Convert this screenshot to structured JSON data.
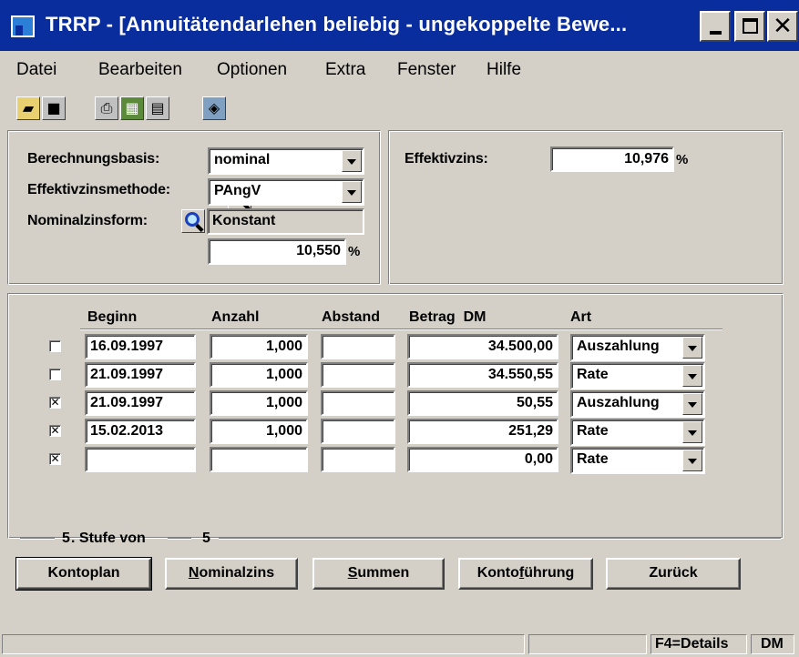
{
  "window": {
    "title": "TRRP - [Annuitätendarlehen beliebig -  ungekoppelte Bewe...",
    "minimize": "_",
    "maximize": "□",
    "close": "✕"
  },
  "menu": [
    "Datei",
    "Bearbeiten",
    "Optionen",
    "Extra",
    "Fenster",
    "Hilfe"
  ],
  "toolbar": {
    "icons": [
      "open-folder-icon",
      "save-disk-icon",
      "print-icon",
      "calculator-icon",
      "form-icon",
      "cards-icon",
      "search-icon"
    ]
  },
  "settings": {
    "berechnungsbasis_label": "Berechnungsbasis:",
    "berechnungsbasis_value": "nominal",
    "effektivzinsmethode_label": "Effektivzinsmethode:",
    "effektivzinsmethode_value": "PAngV",
    "nominalzinsform_label": "Nominalzinsform:",
    "nominalzinsform_value": "Konstant",
    "nominalzins_value": "10,550",
    "percent": "%"
  },
  "effektiv": {
    "label": "Effektivzins:",
    "value": "10,976",
    "percent": "%"
  },
  "table": {
    "headers": {
      "beginn": "Beginn",
      "anzahl": "Anzahl",
      "abstand": "Abstand",
      "betrag": "Betrag  DM",
      "art": "Art"
    },
    "rows": [
      {
        "checked": "",
        "beginn": "16.09.1997",
        "anzahl": "1,000",
        "abstand": "",
        "betrag": "34.500,00",
        "art": "Auszahlung"
      },
      {
        "checked": "",
        "beginn": "21.09.1997",
        "anzahl": "1,000",
        "abstand": "",
        "betrag": "34.550,55",
        "art": "Rate"
      },
      {
        "checked": "✕",
        "beginn": "21.09.1997",
        "anzahl": "1,000",
        "abstand": "",
        "betrag": "50,55",
        "art": "Auszahlung"
      },
      {
        "checked": "✕",
        "beginn": "15.02.2013",
        "anzahl": "1,000",
        "abstand": "",
        "betrag": "251,29",
        "art": "Rate"
      },
      {
        "checked": "✕",
        "beginn": "",
        "anzahl": "",
        "abstand": "",
        "betrag": "0,00",
        "art": "Rate"
      }
    ]
  },
  "stufe": {
    "current": "5",
    "text": ". Stufe von",
    "total": "5"
  },
  "buttons": {
    "kontoplan": "Kontoplan",
    "nominalzins_first": "N",
    "nominalzins_rest": "ominalzins",
    "summen_first": "S",
    "summen_rest": "ummen",
    "kontofuehrung_pre": "Konto",
    "kontofuehrung_ul": "f",
    "kontofuehrung_post": "ührung",
    "zurueck": "Zurück"
  },
  "status": {
    "details": "F4=Details",
    "currency": "DM"
  }
}
